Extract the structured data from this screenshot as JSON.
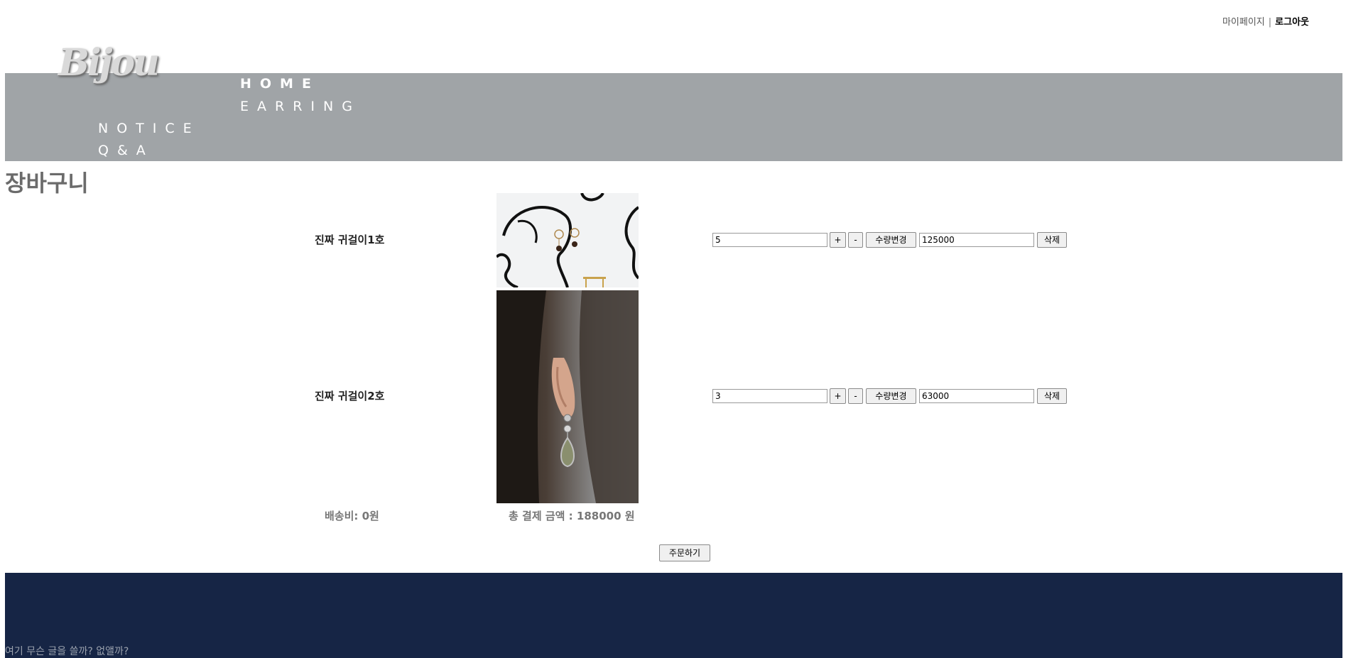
{
  "topbar": {
    "mypage": "마이페이지",
    "separator": "|",
    "logout": "로그아웃"
  },
  "logo": {
    "text": "Bijou"
  },
  "nav": {
    "home": "HOME",
    "earring": "EARRING",
    "notice": "NOTICE",
    "qa": "Q&A"
  },
  "page": {
    "title": "장바구니"
  },
  "cart": {
    "items": [
      {
        "name": "진짜 귀걸이1호",
        "quantity": "5",
        "price": "125000",
        "plus": "+",
        "minus": "-",
        "change": "수량변경",
        "delete": "삭제"
      },
      {
        "name": "진짜 귀걸이2호",
        "quantity": "3",
        "price": "63000",
        "plus": "+",
        "minus": "-",
        "change": "수량변경",
        "delete": "삭제"
      }
    ],
    "shipping": "배송비: 0원",
    "total": "총 결제 금액 : 188000 원",
    "order": "주문하기"
  },
  "footer": {
    "text": "여기 무슨 글을 쓸까? 없앨까?"
  },
  "colors": {
    "header_band": "#a0a4a7",
    "footer": "#162545",
    "title": "#6b6b6b"
  }
}
